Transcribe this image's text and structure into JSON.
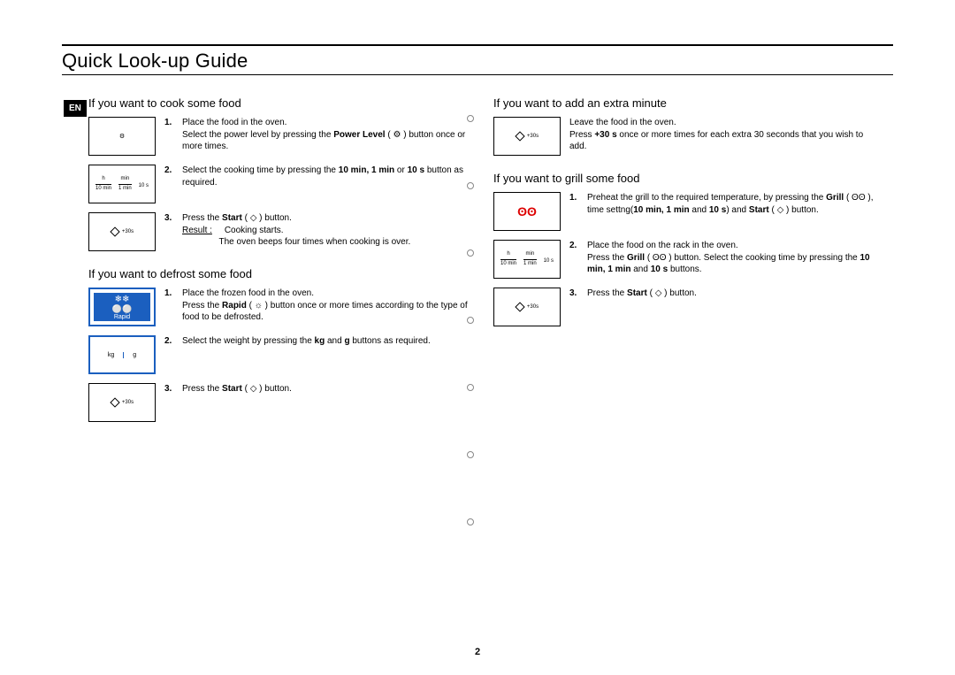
{
  "lang_badge": "EN",
  "title": "Quick Look-up Guide",
  "page_number": "2",
  "icons": {
    "power_level": "⚙",
    "rapid_label": "Rapid",
    "plus30": "+30s",
    "kg": "kg",
    "g": "g",
    "grill": "ʘʘ",
    "time_h": "h",
    "time_min": "min",
    "time_10min": "10 min",
    "time_1min": "1 min",
    "time_10s": "10 s"
  },
  "left": {
    "cook": {
      "heading": "If you want to cook some food",
      "steps": [
        {
          "num": "1.",
          "text_a": "Place the food in the oven.",
          "text_b": "Select the power level by pressing the ",
          "bold": "Power Level",
          "text_c": " ( ⚙ ) button once or more times."
        },
        {
          "num": "2.",
          "text_a": "Select the cooking time by pressing the ",
          "bold": "10 min, 1 min",
          "text_b": " or ",
          "bold2": "10 s",
          "text_c": " button as required."
        },
        {
          "num": "3.",
          "text_a": "Press the ",
          "bold": "Start",
          "text_b": " ( ◇ ) button.",
          "result_label": "Result :",
          "result_a": "Cooking starts.",
          "result_b": "The oven beeps four times when cooking is over."
        }
      ]
    },
    "defrost": {
      "heading": "If you want to defrost some food",
      "steps": [
        {
          "num": "1.",
          "text_a": "Place the frozen food in the oven.",
          "text_b": "Press the ",
          "bold": "Rapid",
          "text_c": " ( ☼ ) button once or more times according to the type of food to be defrosted."
        },
        {
          "num": "2.",
          "text_a": "Select the weight by pressing the ",
          "bold": "kg",
          "text_b": " and ",
          "bold2": "g",
          "text_c": " buttons as required."
        },
        {
          "num": "3.",
          "text_a": "Press the ",
          "bold": "Start",
          "text_b": " ( ◇ ) button."
        }
      ]
    }
  },
  "right": {
    "extra": {
      "heading": "If you want to add an extra minute",
      "text_a": "Leave the food in the oven.",
      "text_b": "Press ",
      "bold": "+30 s",
      "text_c": " once or more times for each extra 30 seconds that you wish to add."
    },
    "grill": {
      "heading": "If you want to grill some food",
      "steps": [
        {
          "num": "1.",
          "text_a": "Preheat the grill to the required temperature, by pressing the ",
          "bold": "Grill",
          "text_b": " ( ʘʘ ), time settng(",
          "bold2": "10 min, 1 min",
          "text_c": " and ",
          "bold3": "10 s",
          "text_d": ") and ",
          "bold4": "Start",
          "text_e": " ( ◇ ) button."
        },
        {
          "num": "2.",
          "text_a": "Place the food on the rack in the oven.",
          "text_b": "Press the ",
          "bold": "Grill",
          "text_c": " ( ʘʘ ) button. Select the cooking time by pressing the ",
          "bold2": "10 min, 1 min",
          "text_d": " and ",
          "bold3": "10 s",
          "text_e": " buttons."
        },
        {
          "num": "3.",
          "text_a": "Press the ",
          "bold": "Start",
          "text_b": " ( ◇ ) button."
        }
      ]
    }
  }
}
